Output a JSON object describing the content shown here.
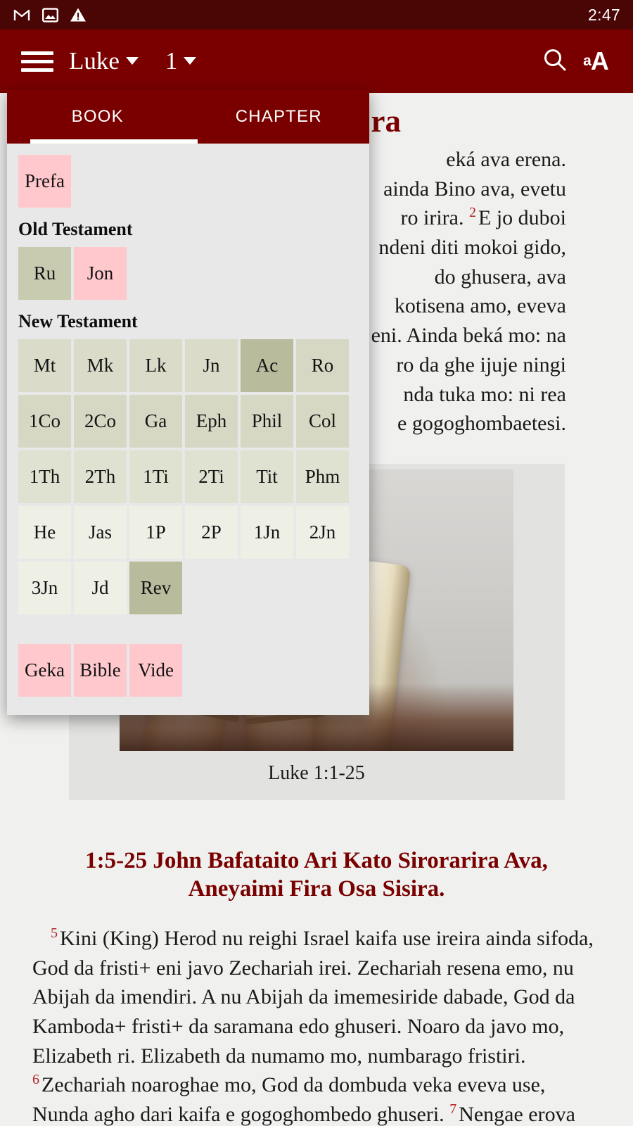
{
  "statusbar": {
    "icons": [
      "gmail-icon",
      "image-icon",
      "warning-icon"
    ],
    "time": "2:47"
  },
  "appbar": {
    "menu_icon": "hamburger-icon",
    "book_label": "Luke",
    "chapter_label": "1",
    "search_icon": "search-icon",
    "textsize_small": "a",
    "textsize_big": "A"
  },
  "panel": {
    "tabs": [
      {
        "label": "BOOK",
        "active": true
      },
      {
        "label": "CHAPTER",
        "active": false
      }
    ],
    "front_matter": [
      {
        "label": "Prefa",
        "style": "pink"
      }
    ],
    "old_testament": {
      "heading": "Old Testament",
      "books": [
        {
          "label": "Ru",
          "style": "o1"
        },
        {
          "label": "Jon",
          "style": "pink"
        }
      ]
    },
    "new_testament": {
      "heading": "New Testament",
      "books": [
        {
          "label": "Mt",
          "style": "o3"
        },
        {
          "label": "Mk",
          "style": "o3"
        },
        {
          "label": "Lk",
          "style": "o3"
        },
        {
          "label": "Jn",
          "style": "o3"
        },
        {
          "label": "Ac",
          "style": "sel"
        },
        {
          "label": "Ro",
          "style": "o2"
        },
        {
          "label": "1Co",
          "style": "o2"
        },
        {
          "label": "2Co",
          "style": "o2"
        },
        {
          "label": "Ga",
          "style": "o2"
        },
        {
          "label": "Eph",
          "style": "o2"
        },
        {
          "label": "Phil",
          "style": "o2"
        },
        {
          "label": "Col",
          "style": "o2"
        },
        {
          "label": "1Th",
          "style": "o4"
        },
        {
          "label": "2Th",
          "style": "o4"
        },
        {
          "label": "1Ti",
          "style": "o4"
        },
        {
          "label": "2Ti",
          "style": "o4"
        },
        {
          "label": "Tit",
          "style": "o4"
        },
        {
          "label": "Phm",
          "style": "o4"
        },
        {
          "label": "He",
          "style": "o6"
        },
        {
          "label": "Jas",
          "style": "o6"
        },
        {
          "label": "1P",
          "style": "o6"
        },
        {
          "label": "2P",
          "style": "o6"
        },
        {
          "label": "1Jn",
          "style": "o6"
        },
        {
          "label": "2Jn",
          "style": "o6"
        },
        {
          "label": "3Jn",
          "style": "o6"
        },
        {
          "label": "Jd",
          "style": "o6"
        },
        {
          "label": "Rev",
          "style": "sel"
        }
      ]
    },
    "back_matter": [
      {
        "label": "Geka",
        "style": "pink"
      },
      {
        "label": "Bible",
        "style": "pink"
      },
      {
        "label": "Vide",
        "style": "pink"
      }
    ]
  },
  "page": {
    "chapter_title_visible": "ra",
    "verse_fragment_lines": [
      "eká ava erena.",
      "ainda Bino ava, evetu",
      "ro irira.",
      "ndeni diti mokoi gido,",
      "do ghusera, ava",
      "kotisena amo, eveva",
      "eni. Ainda beká mo: na",
      "ro da ghe ijuje ningi",
      "nda tuka mo: ni rea",
      "e gogoghombaetesi."
    ],
    "verse_fragment_marker": "2",
    "verse_fragment_after_marker": "E jo duboi",
    "figure_caption": "Luke 1:1-25",
    "section_heading": "1:5-25 John Bafataito Ari Kato Sirorarira Ava, Aneyaimi Fira Osa Sisira.",
    "body": {
      "v5_num": "5",
      "v5_text": "Kini (King) Herod nu reighi Israel kaifa use ireira ainda sifoda, God da fristi+ eni javo Zechariah irei. Zechariah resena emo, nu Abijah da imendiri. A nu Abijah da imemesiride dabade, God da Kamboda+ fristi+ da saramana edo ghuseri. Noaro da javo mo, Elizabeth ri. Elizabeth da numamo mo, numbarago fristiri.",
      "v6_num": "6",
      "v6_text": "Zechariah noaroghae mo, God da dombuda veka eveva use, Nunda agho dari kaifa e gogoghombedo ghuseri.",
      "v7_num": "7",
      "v7_text": "Nengae erova"
    }
  },
  "colors": {
    "statusbar": "#4a0505",
    "appbar": "#7a0000",
    "accent_red": "#7a0000",
    "verse_number": "#b32222",
    "panel_bg": "#e8e8e8",
    "page_bg": "#f0f0ef",
    "selected_cell": "#b8bb9c",
    "pink_cell": "#ffc8cd"
  }
}
